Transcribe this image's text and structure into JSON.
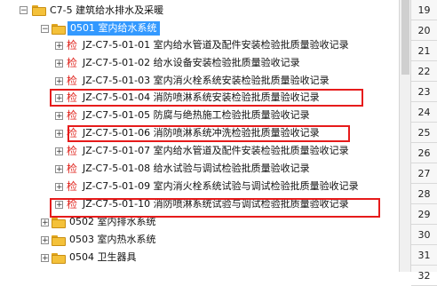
{
  "tree": {
    "root": {
      "code": "C7-5",
      "label": "建筑给水排水及采暖"
    },
    "group_open": {
      "code": "0501",
      "label": "室内给水系统"
    },
    "check_label": "检",
    "items": [
      {
        "code": "JZ-C7-5-01-01",
        "label": "室内给水管道及配件安装检验批质量验收记录"
      },
      {
        "code": "JZ-C7-5-01-02",
        "label": "给水设备安装检验批质量验收记录"
      },
      {
        "code": "JZ-C7-5-01-03",
        "label": "室内消火栓系统安装检验批质量验收记录"
      },
      {
        "code": "JZ-C7-5-01-04",
        "label": "消防喷淋系统安装检验批质量验收记录"
      },
      {
        "code": "JZ-C7-5-01-05",
        "label": "防腐与绝热施工检验批质量验收记录"
      },
      {
        "code": "JZ-C7-5-01-06",
        "label": "消防喷淋系统冲洗检验批质量验收记录"
      },
      {
        "code": "JZ-C7-5-01-07",
        "label": "室内给水管道及配件安装检验批质量验收记录"
      },
      {
        "code": "JZ-C7-5-01-08",
        "label": "给水试验与调试检验批质量验收记录"
      },
      {
        "code": "JZ-C7-5-01-09",
        "label": "室内消火栓系统试验与调试检验批质量验收记录"
      },
      {
        "code": "JZ-C7-5-01-10",
        "label": "消防喷淋系统试验与调试检验批质量验收记录"
      }
    ],
    "groups_closed": [
      {
        "code": "0502",
        "label": "室内排水系统"
      },
      {
        "code": "0503",
        "label": "室内热水系统"
      },
      {
        "code": "0504",
        "label": "卫生器具"
      }
    ],
    "highlight_color": "#e61b1b",
    "selection_color": "#3399ff"
  },
  "row_numbers": [
    "19",
    "20",
    "21",
    "22",
    "23",
    "24",
    "25",
    "26",
    "27",
    "28",
    "29",
    "30",
    "31",
    "32"
  ]
}
